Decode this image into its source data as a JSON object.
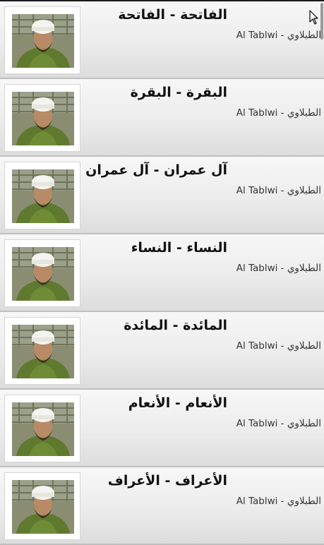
{
  "items": [
    {
      "title": "الفاتحة - الفاتحة",
      "subtitle": "الطبلاوي - Al Tablwi"
    },
    {
      "title": "البقرة - البقرة",
      "subtitle": "الطبلاوي - Al Tablwi"
    },
    {
      "title": "آل عمران - آل عمران",
      "subtitle": "الطبلاوي - Al Tablwi"
    },
    {
      "title": "النساء - النساء",
      "subtitle": "الطبلاوي - Al Tablwi"
    },
    {
      "title": "المائدة - المائدة",
      "subtitle": "الطبلاوي - Al Tablwi"
    },
    {
      "title": "الأنعام - الأنعام",
      "subtitle": "الطبلاوي - Al Tablwi"
    },
    {
      "title": "الأعراف - الأعراف",
      "subtitle": "الطبلاوي - Al Tablwi"
    }
  ],
  "colors": {
    "row_top": "#f7f7f7",
    "row_bottom": "#dcdcdc",
    "robe": "#5f7a2e",
    "turban": "#f4f4f0"
  },
  "icons": {
    "thumbnail": "reciter-photo",
    "cursor": "mouse-pointer-icon"
  }
}
